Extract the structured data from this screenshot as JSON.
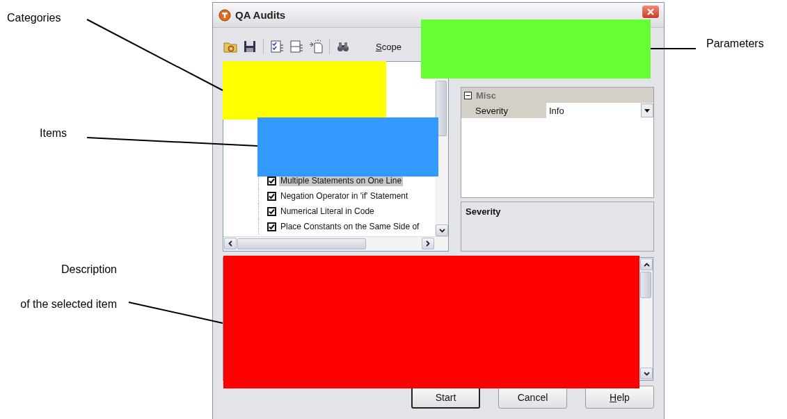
{
  "annotations": [
    {
      "text": "Categories"
    },
    {
      "text": "Items"
    },
    {
      "text": "Description"
    },
    {
      "text": "of the selected item"
    },
    {
      "text": "Parameters"
    }
  ],
  "window": {
    "title": "QA Audits"
  },
  "toolbar": {
    "scope_label": "Scope"
  },
  "items": [
    {
      "label": "Multiple Statements on One Line",
      "checked": true,
      "selected": true
    },
    {
      "label": "Negation Operator in 'if' Statement",
      "checked": true,
      "selected": false
    },
    {
      "label": "Numerical Literal in Code",
      "checked": true,
      "selected": false
    },
    {
      "label": "Place Constants on the Same Side of",
      "checked": true,
      "selected": false
    }
  ],
  "properties": {
    "category": "Misc",
    "expanded": true,
    "rows": [
      {
        "name": "Severity",
        "value": "Info"
      }
    ]
  },
  "help_pane": {
    "title": "Severity"
  },
  "buttons": [
    {
      "label": "Start",
      "default": true
    },
    {
      "label": "Cancel",
      "default": false
    },
    {
      "label": "Help",
      "default": false
    }
  ],
  "overlays": [
    {
      "color": "#ffff00"
    },
    {
      "color": "#3399ff"
    },
    {
      "color": "#66ff33"
    },
    {
      "color": "#ff0000"
    }
  ]
}
